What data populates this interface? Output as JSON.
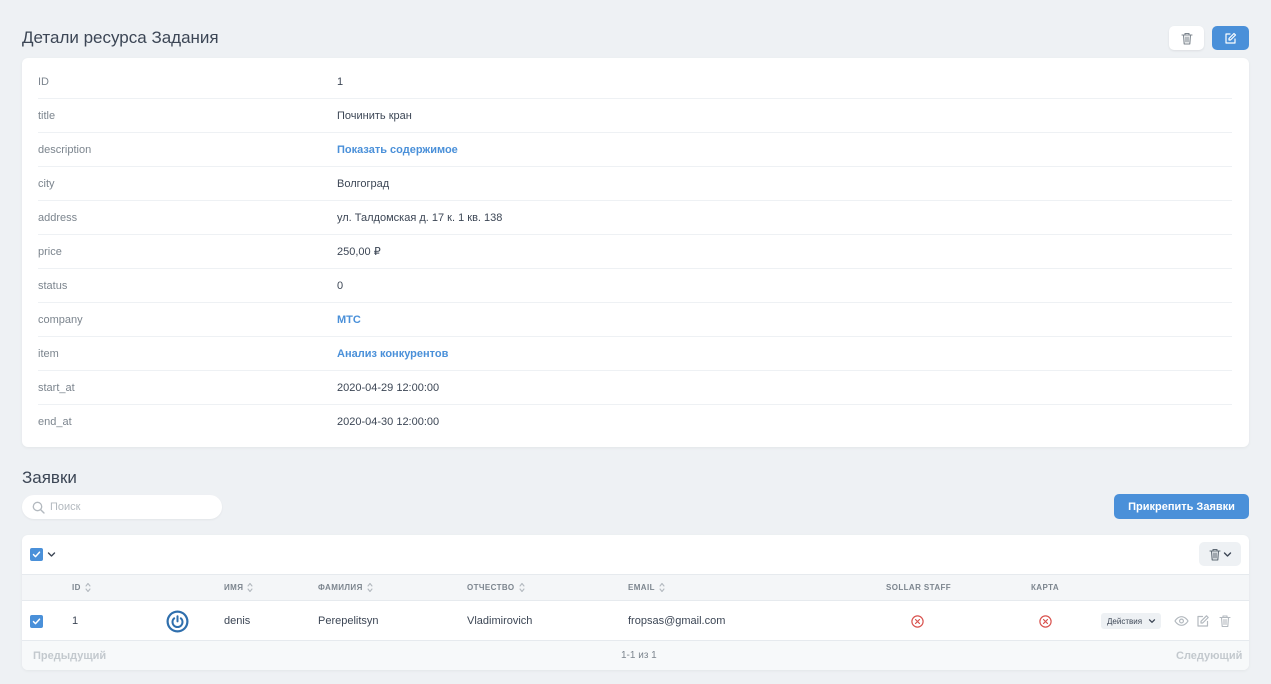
{
  "page": {
    "title": "Детали ресурса Задания"
  },
  "details": [
    {
      "key": "ID",
      "value": "1",
      "link": false
    },
    {
      "key": "title",
      "value": "Починить кран",
      "link": false
    },
    {
      "key": "description",
      "value": "Показать содержимое",
      "link": true
    },
    {
      "key": "city",
      "value": "Волгоград",
      "link": false
    },
    {
      "key": "address",
      "value": "ул. Талдомская д. 17 к. 1 кв. 138",
      "link": false
    },
    {
      "key": "price",
      "value": "250,00 ₽",
      "link": false
    },
    {
      "key": "status",
      "value": "0",
      "link": false
    },
    {
      "key": "company",
      "value": "МТС",
      "link": true
    },
    {
      "key": "item",
      "value": "Анализ конкурентов",
      "link": true
    },
    {
      "key": "start_at",
      "value": "2020-04-29 12:00:00",
      "link": false
    },
    {
      "key": "end_at",
      "value": "2020-04-30 12:00:00",
      "link": false
    }
  ],
  "orders": {
    "title": "Заявки",
    "search_placeholder": "Поиск",
    "attach_label": "Прикрепить Заявки",
    "columns": {
      "id": "ID",
      "name": "ИМЯ",
      "surname": "ФАМИЛИЯ",
      "patronymic": "ОТЧЕСТВО",
      "email": "EMAIL",
      "sollar_staff": "SOLLAR STAFF",
      "card": "КАРТА"
    },
    "rows": [
      {
        "id": "1",
        "name": "denis",
        "surname": "Perepelitsyn",
        "patronymic": "Vladimirovich",
        "email": "fropsas@gmail.com",
        "sollar_staff": false,
        "card": false,
        "actions_label": "Действия"
      }
    ],
    "pagination": {
      "prev": "Предыдущий",
      "info": "1-1 из 1",
      "next": "Следующий"
    }
  },
  "colors": {
    "accent": "#4a90d9",
    "danger": "#d9534f",
    "background": "#eef1f4"
  }
}
